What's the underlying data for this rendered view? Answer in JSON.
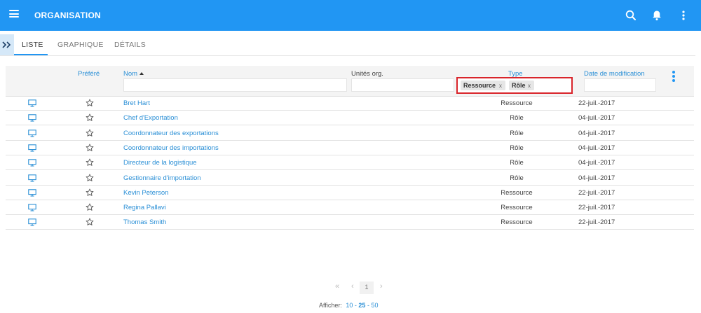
{
  "header": {
    "title": "ORGANISATION",
    "bg_color": "#2196f3",
    "icons": [
      "menu-icon",
      "search-icon",
      "bell-icon",
      "kebab-menu-icon"
    ]
  },
  "panel_toggle": {
    "label": ">>"
  },
  "tabs": [
    {
      "label": "LISTE",
      "active": true
    },
    {
      "label": "GRAPHIQUE",
      "active": false
    },
    {
      "label": "DÉTAILS",
      "active": false
    }
  ],
  "columns": {
    "prefere": "Préféré",
    "nom": "Nom",
    "unites": "Unités org.",
    "type": "Type",
    "date": "Date de modification"
  },
  "type_filter": {
    "chips": [
      "Ressource",
      "Rôle"
    ],
    "remove": "x"
  },
  "rows": [
    {
      "name": "Bret Hart",
      "type": "Ressource",
      "date": "22-juil.-2017"
    },
    {
      "name": "Chef d'Exportation",
      "type": "Rôle",
      "date": "04-juil.-2017"
    },
    {
      "name": "Coordonnateur des exportations",
      "type": "Rôle",
      "date": "04-juil.-2017"
    },
    {
      "name": "Coordonnateur des importations",
      "type": "Rôle",
      "date": "04-juil.-2017"
    },
    {
      "name": "Directeur de la logistique",
      "type": "Rôle",
      "date": "04-juil.-2017"
    },
    {
      "name": "Gestionnaire d'importation",
      "type": "Rôle",
      "date": "04-juil.-2017"
    },
    {
      "name": "Kevin Peterson",
      "type": "Ressource",
      "date": "22-juil.-2017"
    },
    {
      "name": "Regina Pallavi",
      "type": "Ressource",
      "date": "22-juil.-2017"
    },
    {
      "name": "Thomas Smith",
      "type": "Ressource",
      "date": "22-juil.-2017"
    }
  ],
  "pagination": {
    "first": "«",
    "prev": "‹",
    "current_page": "1",
    "next": "›",
    "show_label": "Afficher:",
    "page_sizes": [
      "10",
      "25",
      "50"
    ],
    "selected_size": "25",
    "separator": "-"
  },
  "colors": {
    "accent": "#2196f3",
    "link": "#2a8fd6",
    "highlight_border": "#d9252b"
  }
}
